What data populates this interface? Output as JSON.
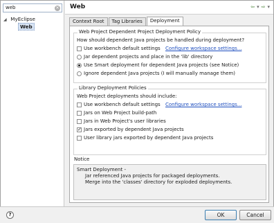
{
  "sidebar": {
    "filter_value": "web",
    "tree": [
      {
        "label": "MyEclipse",
        "children": [
          {
            "label": "Web"
          }
        ]
      }
    ]
  },
  "header": {
    "title": "Web",
    "nav": {
      "back": "⇦",
      "menu": "▾",
      "forward": "⇨",
      "menu2": "▾"
    }
  },
  "tabs": [
    {
      "label": "Context Root"
    },
    {
      "label": "Tag Libraries"
    },
    {
      "label": "Deployment"
    }
  ],
  "project_deploy": {
    "group_label": "Web Project Dependent Project Deployment Policy",
    "question": "How should dependent Java projects be handled during deployment?",
    "use_default": {
      "label": "Use workbench default settings",
      "checked": false
    },
    "configure_link": "Configure workspace settings...",
    "options": [
      {
        "label": "Jar dependent projects and place in the 'lib' directory",
        "selected": false
      },
      {
        "label": "Use Smart deployment for dependent Java projects (see Notice)",
        "selected": true
      },
      {
        "label": "Ignore dependent Java projects (I will manually manage them)",
        "selected": false
      }
    ]
  },
  "library_deploy": {
    "group_label": "Library Deployment Policies",
    "question": "Web Project deployments should include:",
    "use_default": {
      "label": "Use workbench default settings",
      "checked": false
    },
    "configure_link": "Configure workspace settings...",
    "options": [
      {
        "label": "Jars on Web Project build-path",
        "checked": false
      },
      {
        "label": "Jars in Web Project's user libraries",
        "checked": false
      },
      {
        "label": "Jars exported by dependent Java projects",
        "checked": true
      },
      {
        "label": "User library jars exported by dependent Java projects",
        "checked": false
      }
    ]
  },
  "notice": {
    "label": "Notice",
    "title": "Smart Deployment -",
    "line1": "Jar referenced Java projects for packaged deployments.",
    "line2": "Merge into the 'classes' directory for exploded deployments."
  },
  "footer": {
    "help": "?",
    "ok": "OK",
    "cancel": "Cancel"
  }
}
